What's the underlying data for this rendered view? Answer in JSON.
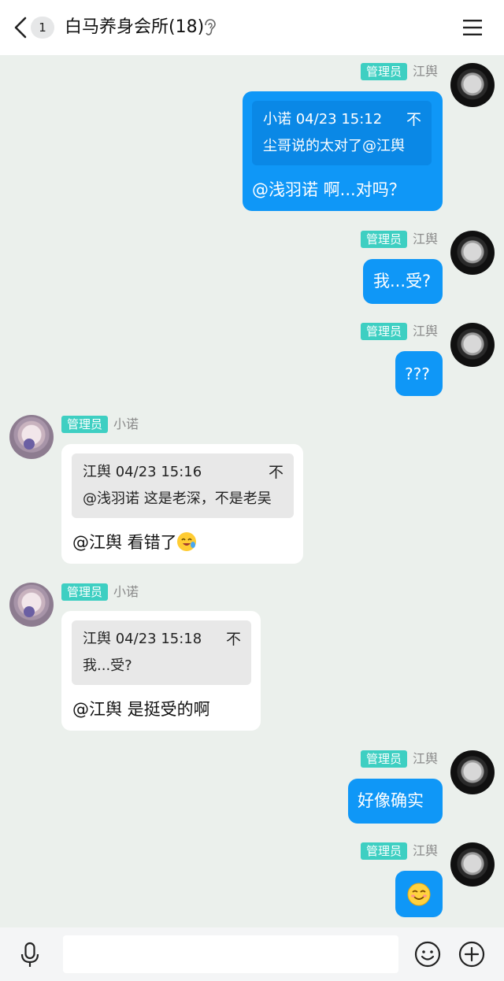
{
  "header": {
    "unread_count": "1",
    "title": "白马养身会所(18)",
    "icons": [
      "back-icon",
      "ear-icon",
      "menu-icon"
    ]
  },
  "messages": [
    {
      "direction": "outgoing",
      "role": "管理员",
      "sender": "江舆",
      "quote": {
        "meta": "小诺 04/23 15:12",
        "text": "尘哥说的太对了@江舆",
        "jump": "不"
      },
      "text": "@浅羽诺 啊...对吗？"
    },
    {
      "direction": "outgoing",
      "role": "管理员",
      "sender": "江舆",
      "text": "我...受?"
    },
    {
      "direction": "outgoing",
      "role": "管理员",
      "sender": "江舆",
      "text": "???"
    },
    {
      "direction": "incoming",
      "role": "管理员",
      "sender": "小诺",
      "quote": {
        "meta": "江舆 04/23 15:16",
        "text": "@浅羽诺 这是老深，不是老吴",
        "jump": "不"
      },
      "text": "@江舆 看错了"
    },
    {
      "direction": "incoming",
      "role": "管理员",
      "sender": "小诺",
      "quote": {
        "meta": "江舆 04/23 15:18",
        "text": "我...受?",
        "jump": "不"
      },
      "text": "@江舆 是挺受的啊"
    },
    {
      "direction": "outgoing",
      "role": "管理员",
      "sender": "江舆",
      "text": "好像确实"
    },
    {
      "direction": "outgoing",
      "role": "管理员",
      "sender": "江舆",
      "text": "",
      "emoji": "smiling-face-emoji"
    }
  ],
  "input_bar": {
    "placeholder": "",
    "icons": [
      "mic-icon",
      "smile-icon",
      "plus-icon"
    ]
  },
  "colors": {
    "background": "#ebf0ec",
    "outgoing_bubble": "#0f97f7",
    "incoming_bubble": "#ffffff",
    "role_badge": "#3ecfc2"
  }
}
